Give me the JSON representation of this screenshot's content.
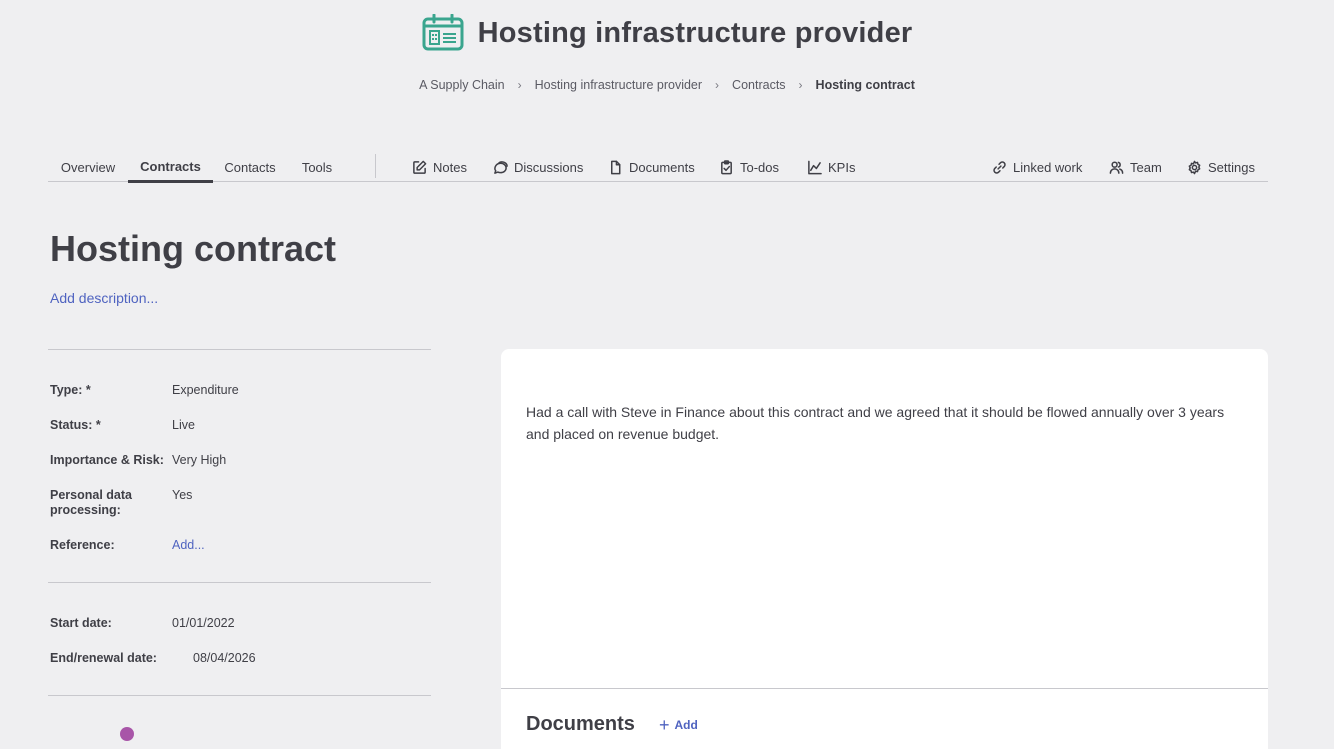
{
  "header": {
    "title": "Hosting infrastructure provider",
    "icon": "calendar-building-icon",
    "accent_color": "#3aa58e"
  },
  "breadcrumb": [
    {
      "label": "A Supply Chain"
    },
    {
      "label": "Hosting infrastructure provider"
    },
    {
      "label": "Contracts"
    },
    {
      "label": "Hosting contract"
    }
  ],
  "tabs": {
    "overview": "Overview",
    "contracts": "Contracts",
    "contacts": "Contacts",
    "tools": "Tools",
    "notes": "Notes",
    "discussions": "Discussions",
    "documents": "Documents",
    "todos": "To-dos",
    "kpis": "KPIs",
    "linked_work": "Linked work",
    "team": "Team",
    "settings": "Settings",
    "active": "Contracts"
  },
  "contract": {
    "title": "Hosting contract",
    "add_description": "Add description..."
  },
  "details": {
    "type_label": "Type: *",
    "type_value": "Expenditure",
    "status_label": "Status: *",
    "status_value": "Live",
    "risk_label": "Importance & Risk:",
    "risk_value": "Very High",
    "pdp_label_1": "Personal data",
    "pdp_label_2": "processing:",
    "pdp_value": "Yes",
    "reference_label": "Reference:",
    "reference_value": "Add...",
    "start_label": "Start date:",
    "start_value": "01/01/2022",
    "end_label": "End/renewal date:",
    "end_value": "08/04/2026"
  },
  "note": {
    "text": "Had a call with Steve in Finance about this contract and we agreed that it should be flowed annually over 3 years and placed on revenue budget."
  },
  "documents": {
    "title": "Documents",
    "add_label": "Add"
  }
}
